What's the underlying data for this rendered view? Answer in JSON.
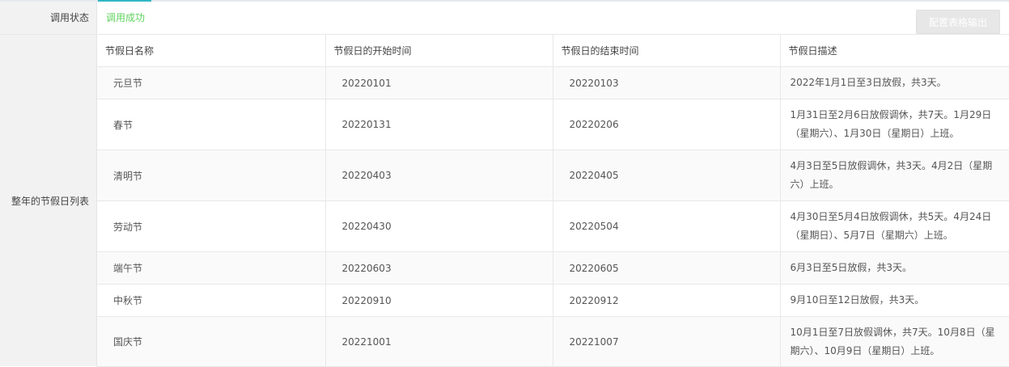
{
  "status": {
    "label": "调用状态",
    "value": "调用成功"
  },
  "list_label": "整年的节假日列表",
  "export_button": "配置表格输出",
  "table": {
    "headers": [
      "节假日名称",
      "节假日的开始时间",
      "节假日的结束时间",
      "节假日描述"
    ],
    "rows": [
      {
        "name": "元旦节",
        "start": "20220101",
        "end": "20220103",
        "desc": "2022年1月1日至3日放假，共3天。"
      },
      {
        "name": "春节",
        "start": "20220131",
        "end": "20220206",
        "desc": "1月31日至2月6日放假调休，共7天。1月29日（星期六）、1月30日（星期日）上班。"
      },
      {
        "name": "清明节",
        "start": "20220403",
        "end": "20220405",
        "desc": "4月3日至5日放假调休，共3天。4月2日（星期六）上班。"
      },
      {
        "name": "劳动节",
        "start": "20220430",
        "end": "20220504",
        "desc": "4月30日至5月4日放假调休，共5天。4月24日（星期日）、5月7日（星期六）上班。"
      },
      {
        "name": "端午节",
        "start": "20220603",
        "end": "20220605",
        "desc": "6月3日至5日放假，共3天。"
      },
      {
        "name": "中秋节",
        "start": "20220910",
        "end": "20220912",
        "desc": "9月10日至12日放假，共3天。"
      },
      {
        "name": "国庆节",
        "start": "20221001",
        "end": "20221007",
        "desc": "10月1日至7日放假调休，共7天。10月8日（星期六）、10月9日（星期日）上班。"
      }
    ]
  }
}
